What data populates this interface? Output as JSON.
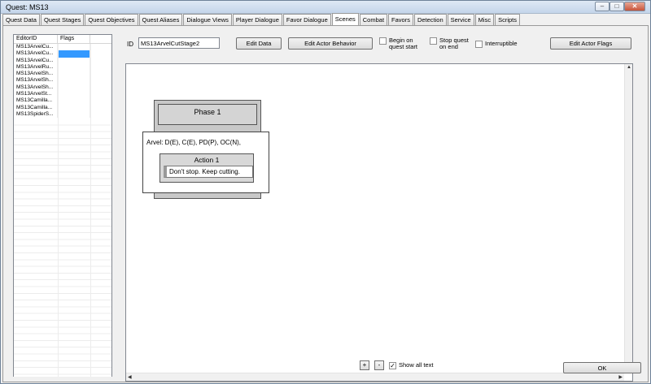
{
  "window": {
    "title": "Quest: MS13"
  },
  "tabs": [
    {
      "label": "Quest Data"
    },
    {
      "label": "Quest Stages"
    },
    {
      "label": "Quest Objectives"
    },
    {
      "label": "Quest Aliases"
    },
    {
      "label": "Dialogue Views"
    },
    {
      "label": "Player Dialogue"
    },
    {
      "label": "Favor Dialogue"
    },
    {
      "label": "Scenes"
    },
    {
      "label": "Combat"
    },
    {
      "label": "Favors"
    },
    {
      "label": "Detection"
    },
    {
      "label": "Service"
    },
    {
      "label": "Misc"
    },
    {
      "label": "Scripts"
    }
  ],
  "active_tab": "Scenes",
  "scene_list": {
    "columns": [
      "EditorID",
      "Flags"
    ],
    "rows": [
      {
        "editor_id": "MS13ArvelCu...",
        "selected": false
      },
      {
        "editor_id": "MS13ArvelCu...",
        "selected": true
      },
      {
        "editor_id": "MS13ArvelCu...",
        "selected": false
      },
      {
        "editor_id": "MS13ArvelRu...",
        "selected": false
      },
      {
        "editor_id": "MS13ArvelSh...",
        "selected": false
      },
      {
        "editor_id": "MS13ArvelSh...",
        "selected": false
      },
      {
        "editor_id": "MS13ArvelSh...",
        "selected": false
      },
      {
        "editor_id": "MS13ArvelSt...",
        "selected": false
      },
      {
        "editor_id": "MS13Camilla...",
        "selected": false
      },
      {
        "editor_id": "MS13Camilla...",
        "selected": false
      },
      {
        "editor_id": "MS13SpiderS...",
        "selected": false
      }
    ]
  },
  "scene": {
    "id_label": "ID",
    "id_value": "MS13ArvelCutStage2",
    "edit_data": "Edit Data",
    "edit_actor_behavior": "Edit Actor Behavior",
    "begin_on_quest_start": {
      "label_line1": "Begin on",
      "label_line2": "quest start",
      "checked": false
    },
    "stop_quest_on_end": {
      "label_line1": "Stop quest",
      "label_line2": "on end",
      "checked": false
    },
    "interruptible": {
      "label": "Interruptible",
      "checked": false
    },
    "edit_actor_flags": "Edit Actor Flags"
  },
  "diagram": {
    "phase_title": "Phase 1",
    "actor_line": "Arvel: D(E), C(E), PD(P), OC(N),",
    "action_title": "Action 1",
    "action_text": "Don't stop. Keep cutting."
  },
  "bottom": {
    "plus": "+",
    "minus": "-",
    "show_all_text": {
      "label": "Show all text",
      "checked": true
    },
    "ok": "OK"
  }
}
